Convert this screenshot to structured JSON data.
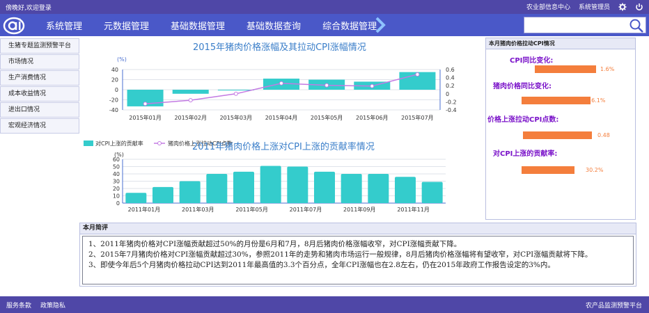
{
  "topbar": {
    "welcome": "傍晚好,欢迎登录",
    "links": [
      "农业部信息中心",
      "系统管理员"
    ]
  },
  "nav": {
    "items": [
      "系统管理",
      "元数据管理",
      "基础数据管理",
      "基础数据查询",
      "综合数据管理"
    ],
    "search_placeholder": ""
  },
  "sidebar": {
    "items": [
      "生猪专题监测预警平台",
      "市场情况",
      "生产消费情况",
      "成本收益情况",
      "进出口情况",
      "宏观经济情况"
    ]
  },
  "colors": {
    "header": "#4f47a7",
    "nav": "#4a58c8",
    "bar_teal": "#34cccc",
    "line_purple": "#c37ae3",
    "accent_orange": "#f47e3c",
    "label_purple": "#7a12c9",
    "title_blue": "#3a7ec9"
  },
  "chart_data": [
    {
      "type": "bar",
      "title": "2015年猪肉价格涨幅及其拉动CPI涨幅情况",
      "categories": [
        "2015年01月",
        "2015年02月",
        "2015年03月",
        "2015年04月",
        "2015年05月",
        "2015年06月",
        "2015年07月"
      ],
      "ylabel": "(%)",
      "ylim": [
        -40,
        40
      ],
      "yticks": [
        "40",
        "20",
        "0",
        "-20",
        "-40"
      ],
      "y2lim": [
        -0.4,
        0.6
      ],
      "y2ticks": [
        "0.6",
        "0.4",
        "0.2",
        "0",
        "-0.2",
        "-0.4"
      ],
      "series": [
        {
          "name": "对CPI上涨的贡献率",
          "kind": "bar",
          "values": [
            -33,
            -8,
            0,
            22,
            20,
            16,
            35
          ]
        },
        {
          "name": "猪肉价格上涨拉动CPI点数",
          "kind": "line",
          "axis": "right",
          "values": [
            -0.25,
            -0.16,
            0.0,
            0.26,
            0.21,
            0.19,
            0.48
          ]
        }
      ],
      "legend_position": "bottom-left",
      "grid": true
    },
    {
      "type": "bar",
      "title": "2011年猪肉价格上涨对CPI上涨的贡献率情况",
      "categories": [
        "2011年01月",
        "2011年02月",
        "2011年03月",
        "2011年04月",
        "2011年05月",
        "2011年06月",
        "2011年07月",
        "2011年08月",
        "2011年09月",
        "2011年10月",
        "2011年11月",
        "2011年12月"
      ],
      "tick_labels": [
        "2011年01月",
        "2011年03月",
        "2011年05月",
        "2011年07月",
        "2011年09月",
        "2011年11月"
      ],
      "ylabel": "(%)",
      "ylim": [
        0,
        60
      ],
      "yticks": [
        "60",
        "50",
        "40",
        "30",
        "20",
        "10",
        "0"
      ],
      "values": [
        14,
        22,
        30,
        40,
        43,
        51,
        50,
        43,
        40,
        40,
        36,
        29
      ],
      "grid": true
    }
  ],
  "cpi_panel": {
    "title": "本月猪肉价格拉动CPI情况",
    "items": [
      {
        "label": "CPI同比变化:",
        "value": "1.6%",
        "fraction": 0.49
      },
      {
        "label": "猪肉价格同比变化:",
        "value": "16.1%",
        "fraction": 0.55
      },
      {
        "label": "价格上涨拉动CPI点数:",
        "value": "0.48",
        "fraction": 0.55
      },
      {
        "label": "对CPI上涨的贡献率:",
        "value": "30.2%",
        "fraction": 0.42
      }
    ]
  },
  "comment": {
    "title": "本月简评",
    "lines": [
      "1、2011年猪肉价格对CPI涨幅贡献超过50%的月份是6月和7月，8月后猪肉价格涨幅收窄，对CPI涨幅贡献下降。",
      "2、2015年7月猪肉价格对CPI涨幅贡献超过30%，参照2011年的走势和猪肉市场运行一般规律，8月后猪肉价格涨幅将有望收窄，对CPI涨幅贡献将下降。",
      "3、即使今年后5个月猪肉价格拉动CPI达到2011年最高值的3.3个百分点，全年CPI涨幅也在2.8左右，仍在2015年政府工作报告设定的3%内。"
    ]
  },
  "footer": {
    "links": [
      "服务条款",
      "政策隐私"
    ],
    "brand": "农产品监测预警平台"
  }
}
